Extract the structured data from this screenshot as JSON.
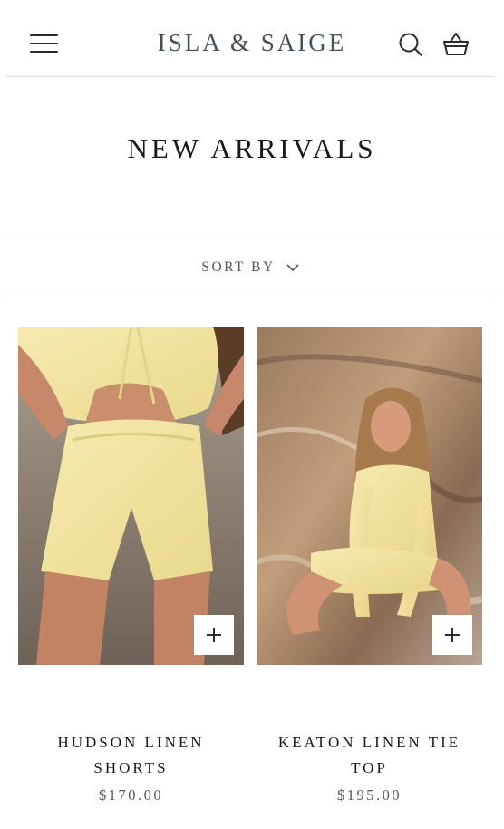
{
  "header": {
    "logo": "ISLA & SAIGE",
    "menu_icon": "hamburger-menu-icon",
    "search_icon": "search-icon",
    "cart_icon": "shopping-basket-icon"
  },
  "page": {
    "title": "NEW ARRIVALS"
  },
  "sort": {
    "label": "SORT BY",
    "icon": "chevron-down-icon"
  },
  "products": [
    {
      "title_line1": "HUDSON LINEN",
      "title_line2": "SHORTS",
      "price": "$170.00",
      "quick_add_icon": "plus-icon"
    },
    {
      "title_line1": "KEATON LINEN TIE",
      "title_line2": "TOP",
      "price": "$195.00",
      "quick_add_icon": "plus-icon"
    }
  ],
  "colors": {
    "text": "#1a1a1a",
    "muted": "#555555",
    "logo": "#46505a",
    "divider": "#dcdcdc",
    "product_fabric": "#f3e3a0"
  }
}
